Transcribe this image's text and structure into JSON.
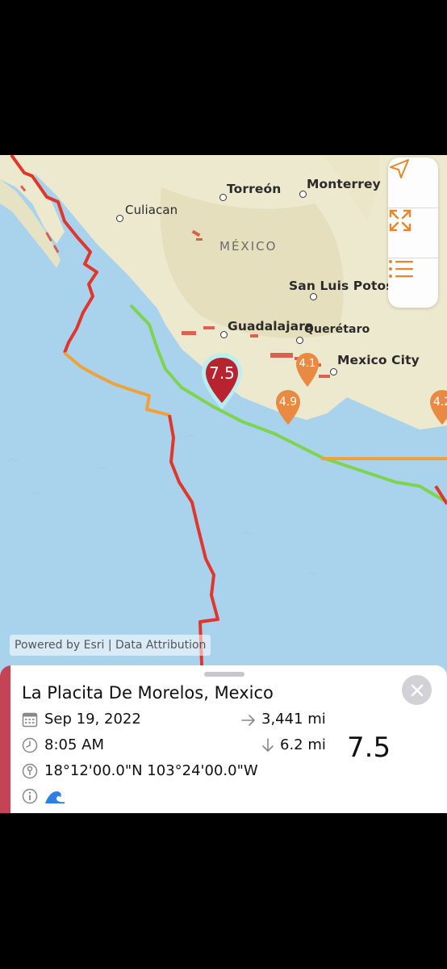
{
  "map": {
    "country": "MÉXICO",
    "cities": [
      {
        "name": "Culiacan",
        "bold": false
      },
      {
        "name": "Torreón",
        "bold": true
      },
      {
        "name": "Monterrey",
        "bold": true
      },
      {
        "name": "San Luis Potosi",
        "bold": true
      },
      {
        "name": "Guadalajara",
        "bold": true
      },
      {
        "name": "Querétaro",
        "bold": true
      },
      {
        "name": "Mexico City",
        "bold": true
      }
    ],
    "markers": [
      {
        "magnitude": "7.5",
        "color": "#b8232f",
        "selected": true
      },
      {
        "magnitude": "4.1",
        "color": "#e98a43"
      },
      {
        "magnitude": "4.9",
        "color": "#e98a43"
      },
      {
        "magnitude": "4.2",
        "color": "#e98a43"
      }
    ],
    "fault_colors": {
      "red": "#e0362b",
      "orange": "#f0a23a",
      "green": "#7ed34f"
    },
    "attribution": "Powered by Esri | Data Attribution"
  },
  "controls": {
    "accent": "#e8862a",
    "buttons": [
      "location-arrow-icon",
      "fullscreen-icon",
      "list-icon"
    ]
  },
  "detail": {
    "place": "La Placita De Morelos, Mexico",
    "date": "Sep 19, 2022",
    "time": "8:05 AM",
    "coordinates": "18°12'00.0\"N 103°24'00.0\"W",
    "distance": "3,441 mi",
    "depth": "6.2 mi",
    "magnitude": "7.5",
    "severity_color": "#c44355",
    "tsunami_icon": "wave-icon"
  }
}
